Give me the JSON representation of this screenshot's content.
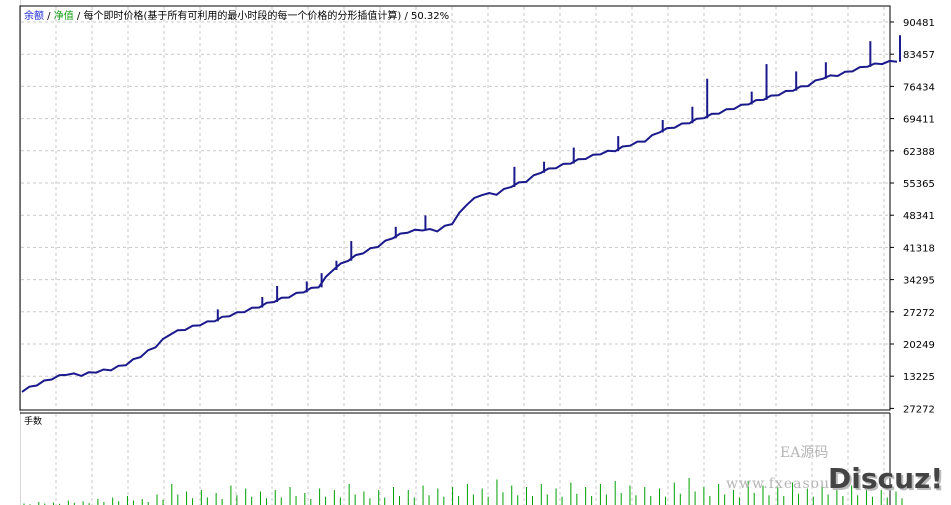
{
  "header": {
    "balance_label": "余额",
    "sep1": " / ",
    "equity_label": "净值",
    "sep2": " / ",
    "description": "每个即时价格(基于所有可利用的最小时段的每一个价格的分形插值计算)",
    "sep3": " / ",
    "quality": "50.32%"
  },
  "volume_panel": {
    "title": "手数"
  },
  "watermark": {
    "text1": "EA源码",
    "text2": "www.fxeasour",
    "logo": "Discuz!"
  },
  "colors": {
    "equity_line": "#1a1a8c",
    "volume_bars": "#00a000",
    "grid": "#c8c8c8"
  },
  "chart_data": {
    "type": "line",
    "y_ticks": [
      "90481",
      "83457",
      "76434",
      "69411",
      "62388",
      "55365",
      "48341",
      "41318",
      "34295",
      "27272",
      "20249",
      "13225",
      "27272"
    ],
    "ylim": [
      6202,
      90481
    ],
    "grid": true,
    "series": [
      {
        "values": [
          9800,
          11200,
          12500,
          13500,
          13300,
          14000,
          14500,
          15600,
          17400,
          19500,
          22300,
          23300,
          24300,
          25200,
          26300,
          27200,
          28200,
          29400,
          30400,
          31500,
          32600,
          36400,
          38400,
          40000,
          41400,
          43300,
          44500,
          45000,
          44800,
          46400,
          50600,
          52700,
          52800,
          54500,
          55600,
          57600,
          58600,
          59600,
          60600,
          61600,
          62300,
          63500,
          64400,
          66400,
          67400,
          68400,
          69500,
          70500,
          71500,
          72500,
          73500,
          74500,
          75500,
          76500,
          78100,
          78700,
          79700,
          80700,
          81300,
          81800
        ],
        "spikes": [
          [
            13,
            2600
          ],
          [
            16,
            2300
          ],
          [
            17,
            3500
          ],
          [
            19,
            2400
          ],
          [
            20,
            3100
          ],
          [
            21,
            2000
          ],
          [
            22,
            4300
          ],
          [
            25,
            2500
          ],
          [
            27,
            3300
          ],
          [
            33,
            4400
          ],
          [
            35,
            2400
          ],
          [
            37,
            3500
          ],
          [
            40,
            3300
          ],
          [
            43,
            2700
          ],
          [
            45,
            3600
          ],
          [
            46,
            8600
          ],
          [
            49,
            2800
          ],
          [
            50,
            7800
          ],
          [
            52,
            4200
          ],
          [
            54,
            3600
          ],
          [
            57,
            5600
          ],
          [
            59,
            5800
          ]
        ]
      }
    ]
  },
  "volume_data": {
    "values": [
      0.05,
      0.1,
      0.08,
      0.15,
      0.12,
      0.2,
      0.25,
      0.3,
      0.2,
      0.35,
      0.7,
      0.45,
      0.5,
      0.4,
      0.65,
      0.55,
      0.45,
      0.5,
      0.6,
      0.4,
      0.55,
      0.5,
      0.7,
      0.45,
      0.5,
      0.6,
      0.5,
      0.65,
      0.55,
      0.6,
      0.7,
      0.55,
      0.85,
      0.65,
      0.6,
      0.7,
      0.55,
      0.75,
      0.6,
      0.7,
      0.8,
      0.65,
      0.6,
      0.55,
      0.75,
      0.9,
      0.6,
      0.7,
      0.5,
      0.8,
      0.65,
      0.6,
      0.75,
      0.55,
      0.7,
      0.6,
      0.65,
      0.55,
      0.5,
      0.45
    ]
  }
}
